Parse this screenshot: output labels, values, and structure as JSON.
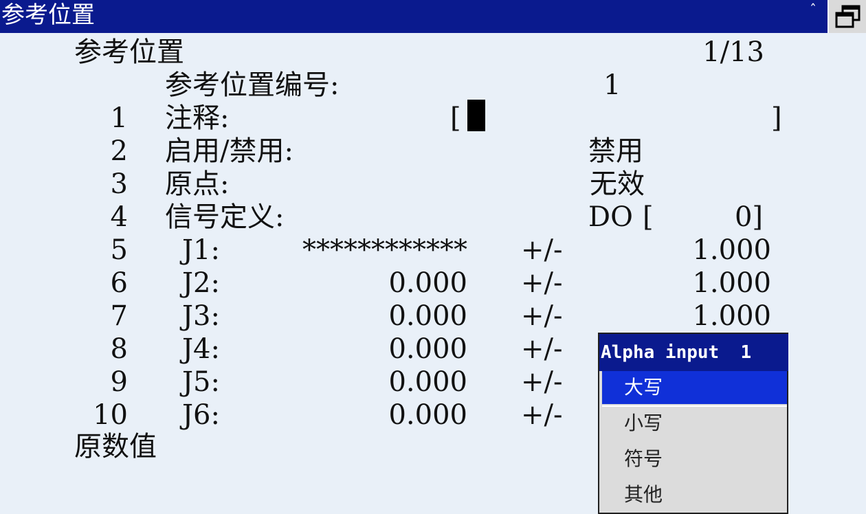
{
  "titlebar": {
    "title": "参考位置",
    "caret": "ˆ"
  },
  "screen": {
    "heading": "参考位置",
    "page": "1/13",
    "ref_label": "参考位置编号:",
    "ref_value": "1",
    "footer": "原数值"
  },
  "rows": [
    {
      "num": "1",
      "label": "注释:",
      "bracket_open": "[",
      "bracket_close": "]"
    },
    {
      "num": "2",
      "label": "启用/禁用:",
      "value": "禁用"
    },
    {
      "num": "3",
      "label": "原点:",
      "value": "无效"
    },
    {
      "num": "4",
      "label": "信号定义:",
      "sig_type": "DO",
      "sig_open": "[",
      "sig_value": "0]"
    }
  ],
  "joints": [
    {
      "num": "5",
      "name": "J1:",
      "value": "************",
      "tol_label": "+/-",
      "tol": "1.000"
    },
    {
      "num": "6",
      "name": "J2:",
      "value": "0.000",
      "tol_label": "+/-",
      "tol": "1.000"
    },
    {
      "num": "7",
      "name": "J3:",
      "value": "0.000",
      "tol_label": "+/-",
      "tol": "1.000"
    },
    {
      "num": "8",
      "name": "J4:",
      "value": "0.000",
      "tol_label": "+/-"
    },
    {
      "num": "9",
      "name": "J5:",
      "value": "0.000",
      "tol_label": "+/-"
    },
    {
      "num": "10",
      "name": "J6:",
      "value": "0.000",
      "tol_label": "+/-"
    }
  ],
  "popup": {
    "title": "Alpha input  1",
    "items": [
      "大写",
      "小写",
      "符号",
      "其他"
    ],
    "selected_index": 0
  },
  "colors": {
    "titlebar_bg": "#0a1a8e",
    "selection_bg": "#1030d8",
    "screen_bg": "#e9f0f8",
    "popup_bg": "#dcdcdc"
  },
  "icons": {
    "window_restore": "restore-window-icon",
    "caret": "caret-up-icon"
  }
}
